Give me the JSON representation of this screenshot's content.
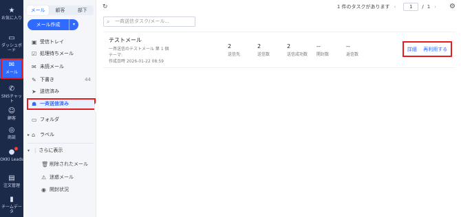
{
  "rail": {
    "favorites": "お気に入り",
    "dashboard": "ダッシュボード",
    "mail": "メール",
    "sns": "SNSチャット",
    "customers": "顧客",
    "deals": "商談",
    "leads": "OKKI Leads",
    "orders": "注文管理",
    "team": "チームデータ"
  },
  "nav": {
    "tabs": [
      "メール",
      "顧客",
      "部下"
    ],
    "compose_label": "メール作成",
    "items": [
      {
        "label": "受信トレイ",
        "count": ""
      },
      {
        "label": "処理待ちメール",
        "count": ""
      },
      {
        "label": "未読メール",
        "count": ""
      },
      {
        "label": "下書き",
        "count": "44"
      },
      {
        "label": "送信済み",
        "count": ""
      },
      {
        "label": "一斉送信済み",
        "count": ""
      },
      {
        "label": "フォルダ",
        "count": ""
      },
      {
        "label": "ラベル",
        "count": ""
      }
    ],
    "more_label": "さらに表示",
    "sub_items": [
      "削除されたメール",
      "迷惑メール",
      "開封状況"
    ]
  },
  "main": {
    "pager_text": "1 件のタスクがあります",
    "page_value": "1",
    "page_sep": "/",
    "page_total": "1",
    "search_placeholder": "一斉送信タスク/メール...",
    "task": {
      "subject": "テストメール",
      "line1": "一斉送信のテストメール 第 1 個",
      "line2": "テーマ:",
      "line3": "作成日時 2026-01-22 08:59",
      "stats": [
        {
          "value": "2",
          "label": "送信先"
        },
        {
          "value": "2",
          "label": "送信数"
        },
        {
          "value": "2",
          "label": "送信成功数"
        },
        {
          "value": "--",
          "label": "開封数"
        },
        {
          "value": "--",
          "label": "返信数"
        }
      ],
      "detail_label": "詳細",
      "reuse_label": "再利用する"
    }
  },
  "colors": {
    "rail_bg": "#1c2a4a",
    "accent": "#2f6bff",
    "highlight": "#e21d1d"
  }
}
